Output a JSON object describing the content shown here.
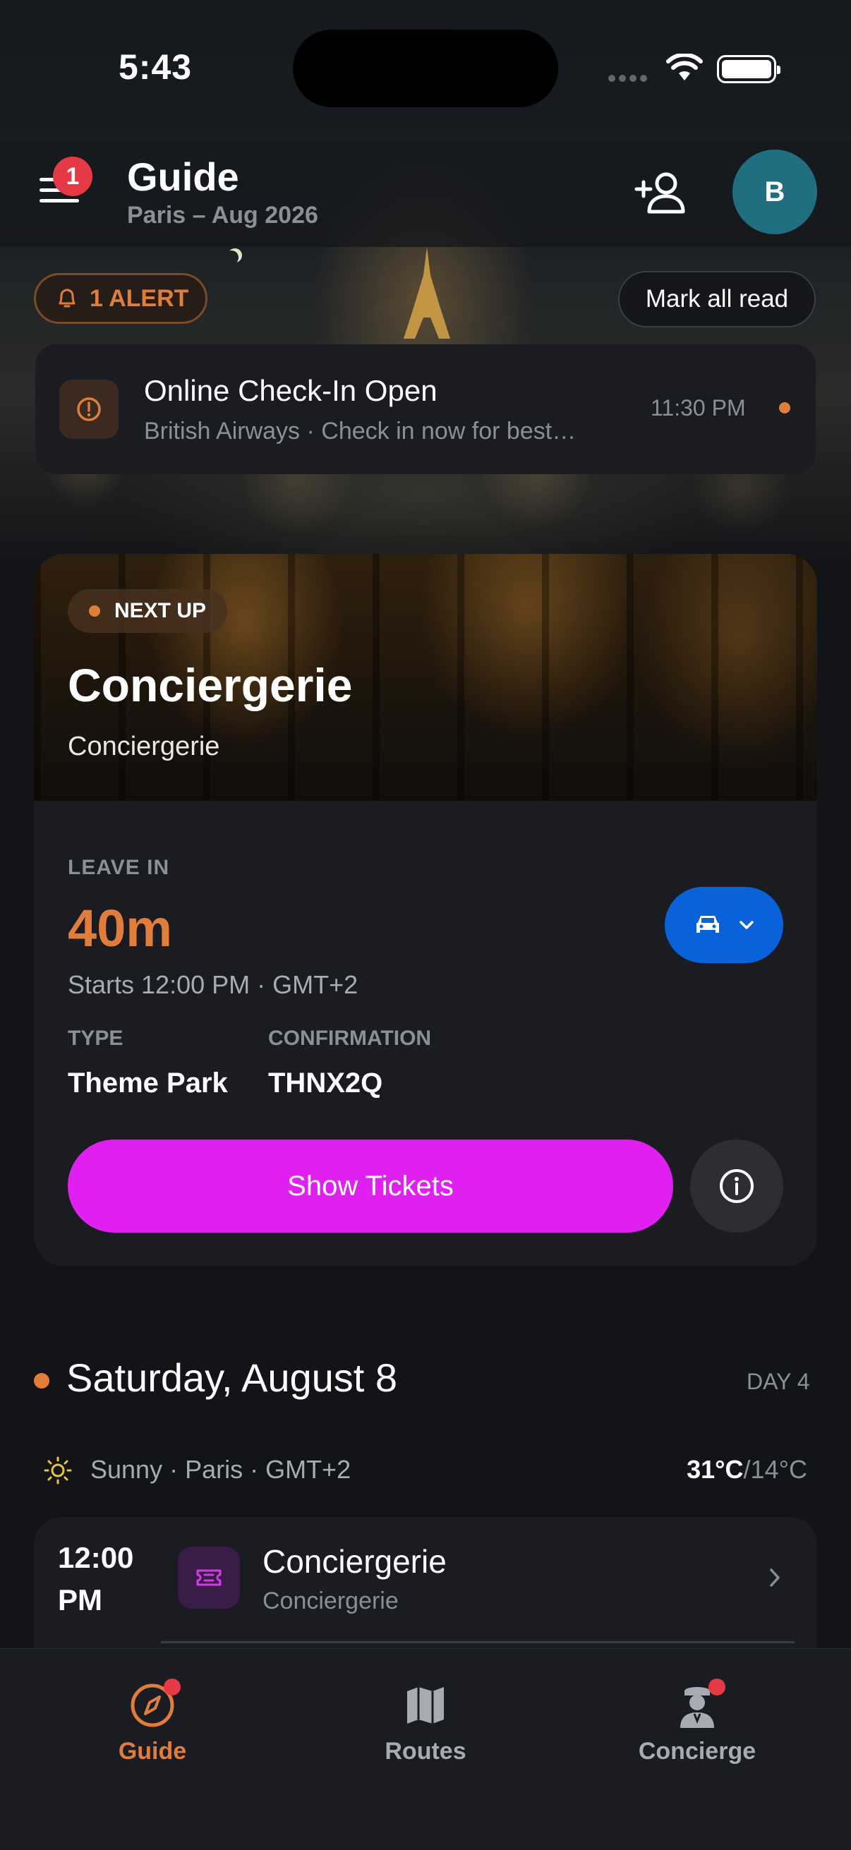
{
  "status_bar": {
    "time": "5:43"
  },
  "header": {
    "title": "Guide",
    "subtitle": "Paris – Aug 2026",
    "menu_badge": "1",
    "avatar_initial": "B"
  },
  "alerts": {
    "pill_label": "1 ALERT",
    "mark_all_label": "Mark all read",
    "items": [
      {
        "title": "Online Check-In Open",
        "subtitle": "British Airways · Check in now for best…",
        "time": "11:30 PM"
      }
    ]
  },
  "next_up": {
    "badge": "NEXT UP",
    "title": "Conciergerie",
    "subtitle": "Conciergerie",
    "leave_label": "LEAVE IN",
    "leave_value": "40m",
    "starts": "Starts 12:00 PM · GMT+2",
    "type_label": "TYPE",
    "type_value": "Theme Park",
    "confirmation_label": "CONFIRMATION",
    "confirmation_value": "THNX2Q",
    "primary_button": "Show Tickets",
    "transport_icon": "car-icon"
  },
  "day": {
    "title": "Saturday, August 8",
    "day_label": "DAY 4",
    "weather": "Sunny · Paris · GMT+2",
    "temp_high": "31°C",
    "temp_low": "/14°C",
    "events": [
      {
        "time": "12:00 PM",
        "title": "Conciergerie",
        "subtitle": "Conciergerie",
        "icon": "ticket-icon"
      }
    ]
  },
  "tabs": [
    {
      "label": "Guide",
      "icon": "compass-icon",
      "active": true,
      "dot": true
    },
    {
      "label": "Routes",
      "icon": "map-icon",
      "active": false,
      "dot": false
    },
    {
      "label": "Concierge",
      "icon": "concierge-icon",
      "active": false,
      "dot": true
    }
  ],
  "colors": {
    "accent": "#e07d3a",
    "primary_button": "#e020f0",
    "transport_button": "#0a62db",
    "badge_red": "#e53945",
    "avatar": "#1f6f80",
    "background": "#121417",
    "card": "#1a1c21"
  }
}
